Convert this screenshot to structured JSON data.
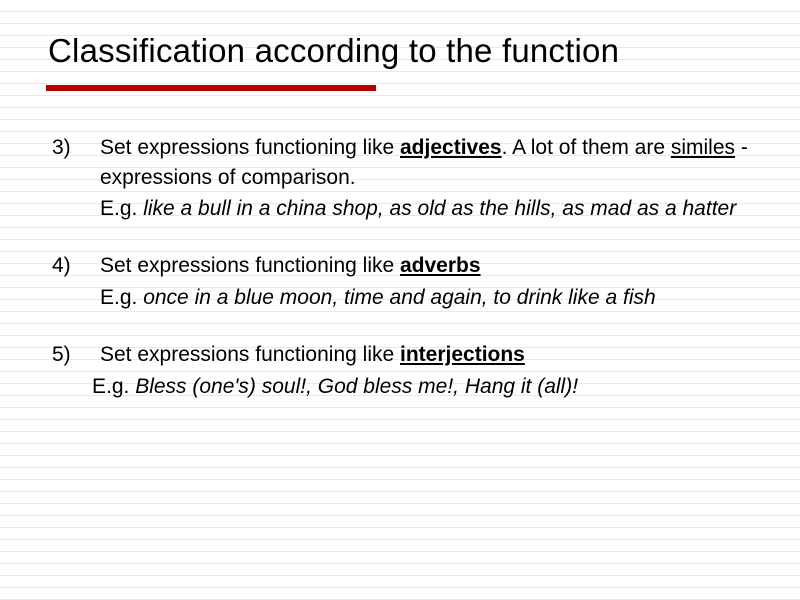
{
  "title": "Classification according to the function",
  "items": [
    {
      "num": "3)",
      "pre1": "Set expressions functioning like ",
      "kw": "adjectives",
      "post1": ". A lot of them are ",
      "kw2": "similes",
      "post2": " - expressions of comparison.",
      "eg_label": "E.g. ",
      "eg": "like a bull in a china shop, as old as the hills, as mad as a hatter"
    },
    {
      "num": "4)",
      "pre1": "Set expressions functioning like ",
      "kw": "adverbs",
      "eg_label": "E.g. ",
      "eg": "once in a blue moon, time and again, to drink like a fish"
    },
    {
      "num": "5)",
      "pre1": "Set expressions functioning like ",
      "kw": "interjections",
      "eg_label": "E.g. ",
      "eg": "Bless (one's) soul!, God bless me!, Hang it (all)!"
    }
  ]
}
